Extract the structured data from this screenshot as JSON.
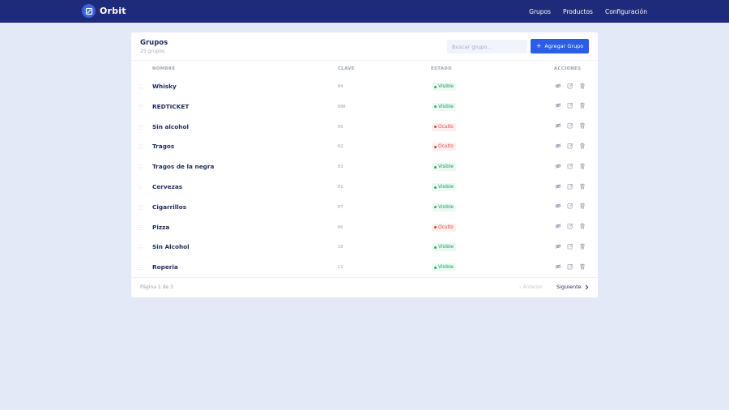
{
  "app": {
    "name": "Orbit",
    "logo_icon": "logo-icon"
  },
  "nav": {
    "items": [
      {
        "label": "Grupos"
      },
      {
        "label": "Productos"
      },
      {
        "label": "Configuración"
      }
    ]
  },
  "card": {
    "title": "Grupos",
    "subtitle": "25 grupos",
    "search_placeholder": "Buscar grupo...",
    "add_button": "Agregar Grupo",
    "add_icon": "plus-icon"
  },
  "table": {
    "headers": {
      "name": "NOMBRE",
      "key": "CLAVE",
      "status": "ESTADO",
      "actions": "ACCIONES"
    },
    "rows": [
      {
        "name": "Whisky",
        "key": "04",
        "status": "Visible"
      },
      {
        "name": "REDTICKET",
        "key": "000",
        "status": "Visible"
      },
      {
        "name": "Sin alcohol",
        "key": "05",
        "status": "Oculto"
      },
      {
        "name": "Tragos",
        "key": "02",
        "status": "Oculto"
      },
      {
        "name": "Tragos de la negra",
        "key": "03",
        "status": "Visible"
      },
      {
        "name": "Cervezas",
        "key": "01",
        "status": "Visible"
      },
      {
        "name": "Cigarrillos",
        "key": "07",
        "status": "Visible"
      },
      {
        "name": "Pizza",
        "key": "06",
        "status": "Oculto"
      },
      {
        "name": "Sin Alcohol",
        "key": "10",
        "status": "Visible"
      },
      {
        "name": "Roperia",
        "key": "11",
        "status": "Visible"
      }
    ],
    "action_icons": [
      "eye-off-icon",
      "edit-icon",
      "trash-icon"
    ]
  },
  "pagination": {
    "page_info": "Página 1 de 3",
    "prev_label": "Anterior",
    "next_label": "Siguiente"
  },
  "colors": {
    "navbar": "#1e2b7a",
    "accent": "#2a5de8",
    "visible": "#1fb567",
    "hidden": "#e0443f",
    "background": "#e3e9f6"
  }
}
